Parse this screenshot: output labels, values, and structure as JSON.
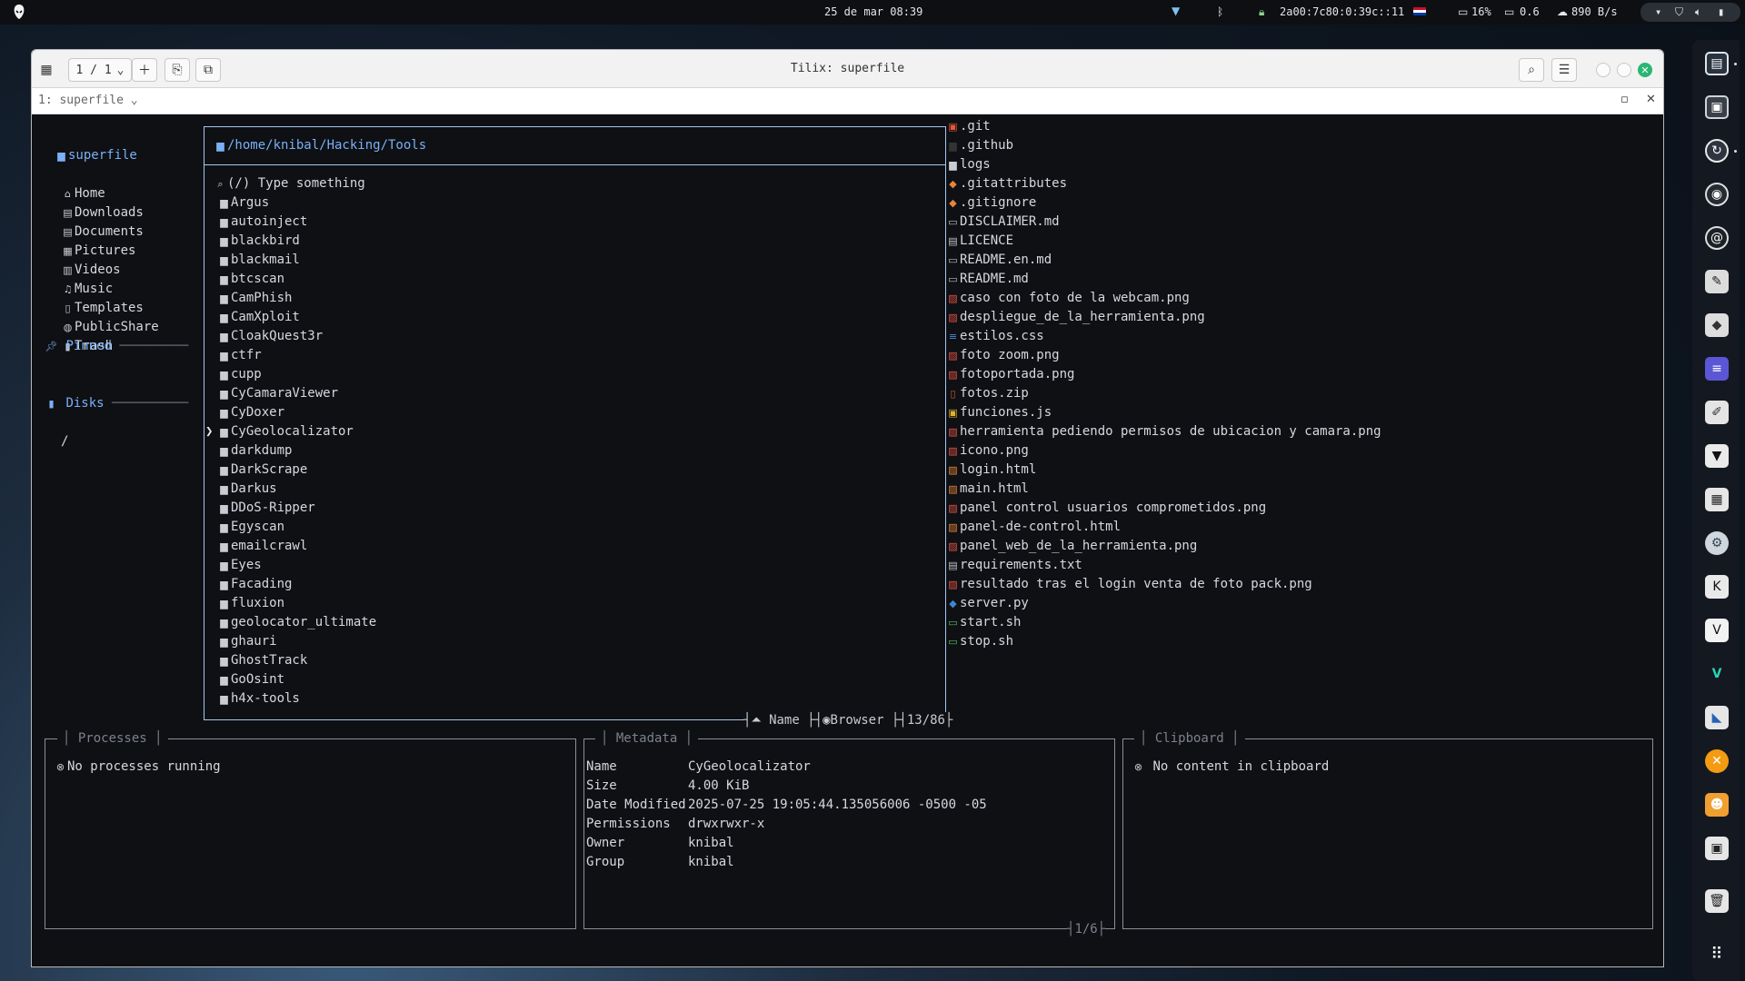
{
  "topbar": {
    "datetime": "25 de mar 08:39",
    "network_address": "2a00:7c80:0:39c::11",
    "cpu": "16%",
    "load": "0.6",
    "net_speed": "890 B/s"
  },
  "window": {
    "title": "Tilix: superfile",
    "session_counter": "1 / 1",
    "session_name": "1: superfile"
  },
  "sidebar": {
    "title": "superfile",
    "items": [
      {
        "label": "Home",
        "icon": "home-icon"
      },
      {
        "label": "Downloads",
        "icon": "download-icon"
      },
      {
        "label": "Documents",
        "icon": "document-icon"
      },
      {
        "label": "Pictures",
        "icon": "picture-icon"
      },
      {
        "label": "Videos",
        "icon": "video-icon"
      },
      {
        "label": "Music",
        "icon": "music-icon"
      },
      {
        "label": "Templates",
        "icon": "template-icon"
      },
      {
        "label": "PublicShare",
        "icon": "globe-icon"
      },
      {
        "label": "Trash",
        "icon": "trash-icon"
      }
    ],
    "pinned_label": "Pinned",
    "disks_label": "Disks",
    "disks": [
      "/"
    ]
  },
  "browser": {
    "path": "/home/knibal/Hacking/Tools",
    "search_placeholder": "(/) Type something",
    "items": [
      "Argus",
      "autoinject",
      "blackbird",
      "blackmail",
      "btcscan",
      "CamPhish",
      "CamXploit",
      "CloakQuest3r",
      "ctfr",
      "cupp",
      "CyCamaraViewer",
      "CyDoxer",
      "CyGeolocalizator",
      "darkdump",
      "DarkScrape",
      "Darkus",
      "DDoS-Ripper",
      "Egyscan",
      "emailcrawl",
      "Eyes",
      "Facading",
      "fluxion",
      "geolocator_ultimate",
      "ghauri",
      "GhostTrack",
      "GoOsint",
      "h4x-tools"
    ],
    "selected_index": 12,
    "sort_label": "Name",
    "mode_label": "Browser",
    "position": "13/86"
  },
  "preview": {
    "files": [
      {
        "name": ".git",
        "type": "git"
      },
      {
        "name": ".github",
        "type": "folder-dark"
      },
      {
        "name": "logs",
        "type": "folder"
      },
      {
        "name": ".gitattributes",
        "type": "git-diamond"
      },
      {
        "name": ".gitignore",
        "type": "git-diamond"
      },
      {
        "name": "DISCLAIMER.md",
        "type": "md"
      },
      {
        "name": "LICENCE",
        "type": "txt"
      },
      {
        "name": "README.en.md",
        "type": "md"
      },
      {
        "name": "README.md",
        "type": "md"
      },
      {
        "name": "caso con foto de la webcam.png",
        "type": "png"
      },
      {
        "name": "despliegue_de_la_herramienta.png",
        "type": "png"
      },
      {
        "name": "estilos.css",
        "type": "css"
      },
      {
        "name": "foto zoom.png",
        "type": "png"
      },
      {
        "name": "fotoportada.png",
        "type": "png"
      },
      {
        "name": "fotos.zip",
        "type": "zip"
      },
      {
        "name": "funciones.js",
        "type": "js"
      },
      {
        "name": "herramienta pediendo permisos de ubicacion y camara.png",
        "type": "png"
      },
      {
        "name": "icono.png",
        "type": "png"
      },
      {
        "name": "login.html",
        "type": "html"
      },
      {
        "name": "main.html",
        "type": "html"
      },
      {
        "name": "panel control usuarios comprometidos.png",
        "type": "png"
      },
      {
        "name": "panel-de-control.html",
        "type": "html"
      },
      {
        "name": "panel_web_de_la_herramienta.png",
        "type": "png"
      },
      {
        "name": "requirements.txt",
        "type": "txt"
      },
      {
        "name": "resultado tras el login venta de foto pack.png",
        "type": "png"
      },
      {
        "name": "server.py",
        "type": "py"
      },
      {
        "name": "start.sh",
        "type": "sh"
      },
      {
        "name": "stop.sh",
        "type": "sh"
      }
    ]
  },
  "processes": {
    "title": "Processes",
    "empty_text": "No processes running"
  },
  "metadata": {
    "title": "Metadata",
    "rows": [
      {
        "key": "Name",
        "value": "CyGeolocalizator"
      },
      {
        "key": "Size",
        "value": "4.00 KiB"
      },
      {
        "key": "Date Modified",
        "value": "2025-07-25 19:05:44.135056006 -0500 -05"
      },
      {
        "key": "Permissions",
        "value": "drwxrwxr-x"
      },
      {
        "key": "Owner",
        "value": "knibal"
      },
      {
        "key": "Group",
        "value": "knibal"
      }
    ],
    "page": "1/6"
  },
  "clipboard": {
    "title": "Clipboard",
    "empty_text": "No content in clipboard"
  },
  "colors": {
    "accent_blue": "#7ab0f5",
    "terminal_bg": "#0e1014",
    "close_green": "#2bb673"
  }
}
